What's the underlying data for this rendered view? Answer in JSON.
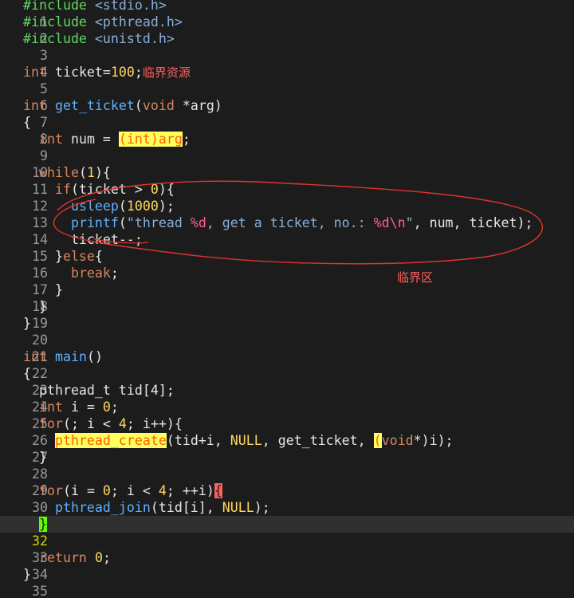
{
  "line_numbers": [
    "1",
    "2",
    "3",
    "4",
    "5",
    "6",
    "7",
    "8",
    "9",
    "10",
    "11",
    "12",
    "13",
    "14",
    "15",
    "16",
    "17",
    "18",
    "19",
    "20",
    "21",
    "22",
    "23",
    "24",
    "25",
    "26",
    "27",
    "28",
    "29",
    "30",
    "31",
    "32",
    "33",
    "34",
    "35"
  ],
  "code": {
    "l1": [
      "#include",
      " <stdio.h>"
    ],
    "l2": [
      "#include",
      " <pthread.h>"
    ],
    "l3": [
      "#include",
      " <unistd.h>"
    ],
    "l5": [
      "int",
      " ticket=",
      "100",
      ";"
    ],
    "l5_note": "临界资源",
    "l7": [
      "int",
      " ",
      "get_ticket",
      "(",
      "void",
      " *arg)"
    ],
    "l8": "{",
    "l9": [
      "  ",
      "int",
      " num = ",
      "(int)arg",
      ";"
    ],
    "l11": [
      "  ",
      "while",
      "(",
      "1",
      "){"
    ],
    "l12": [
      "    ",
      "if",
      "(ticket > ",
      "0",
      "){"
    ],
    "l13": [
      "      ",
      "usleep",
      "(",
      "1000",
      ");"
    ],
    "l14": [
      "      ",
      "printf",
      "(",
      "\"thread ",
      "%d",
      ", get a ticket, no.: ",
      "%d",
      "\\n",
      "\"",
      ", num, ticket);"
    ],
    "l15": "      ticket--;",
    "l16": [
      "    }",
      "else",
      "{"
    ],
    "l17": [
      "      ",
      "break",
      ";"
    ],
    "l18": "    }",
    "l19": "  }",
    "l20": "}",
    "l22": [
      "int",
      " ",
      "main",
      "()"
    ],
    "l23": "{",
    "l24": "  pthread_t tid[4];",
    "l25": [
      "  ",
      "int",
      " i = ",
      "0",
      ";"
    ],
    "l26": [
      "  ",
      "for",
      "(; i < ",
      "4",
      "; i++){"
    ],
    "l27": [
      "    ",
      "pthread_create",
      "(tid+i, ",
      "NULL",
      ", get_ticket, ",
      "(",
      "void",
      "*)i);"
    ],
    "l28": "  }",
    "l30": [
      "  ",
      "for",
      "(i = ",
      "0",
      "; i < ",
      "4",
      "; ++i)",
      "{"
    ],
    "l31": [
      "    ",
      "pthread_join",
      "(tid[i], ",
      "NULL",
      ");"
    ],
    "l32": [
      "  ",
      "}"
    ],
    "l34": [
      "  ",
      "return",
      " ",
      "0",
      ";"
    ],
    "l35": "}"
  },
  "annotation": {
    "label": "临界区",
    "color": "#ff3333"
  },
  "colors": {
    "background": "#1c1c1c",
    "preprocessor": "#5fd75f",
    "keyword": "#d7875f",
    "function": "#5fafff",
    "number": "#ffd75f",
    "string": "#87afd7",
    "format_spec": "#ff5f87",
    "current_line": "#303030"
  }
}
